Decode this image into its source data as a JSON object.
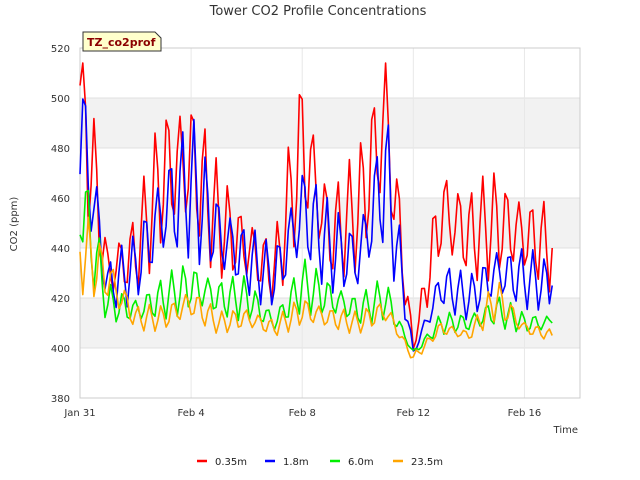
{
  "chart_data": {
    "type": "line",
    "title": "Tower CO2 Profile Concentrations",
    "badge": "TZ_co2prof",
    "xlabel": "Time",
    "ylabel": "CO2 (ppm)",
    "ylim": [
      380,
      520
    ],
    "yticks": [
      "380",
      "400",
      "420",
      "440",
      "460",
      "480",
      "500",
      "520"
    ],
    "xlim": [
      "2016-01-31",
      "2016-02-18"
    ],
    "xticks": [
      {
        "date": "2016-01-31",
        "label": "Jan 31"
      },
      {
        "date": "2016-02-04",
        "label": "Feb 4"
      },
      {
        "date": "2016-02-08",
        "label": "Feb 8"
      },
      {
        "date": "2016-02-12",
        "label": "Feb 12"
      },
      {
        "date": "2016-02-16",
        "label": "Feb 16"
      }
    ],
    "grid": true,
    "legend_position": "bottom",
    "x": [
      "2016-01-31",
      "2016-02-01",
      "2016-02-02",
      "2016-02-03",
      "2016-02-04",
      "2016-02-05",
      "2016-02-06",
      "2016-02-07",
      "2016-02-08",
      "2016-02-09",
      "2016-02-10",
      "2016-02-11",
      "2016-02-12",
      "2016-02-13",
      "2016-02-14",
      "2016-02-15",
      "2016-02-16",
      "2016-02-17"
    ],
    "series": [
      {
        "name": "0.35m",
        "color": "#ff0000",
        "values": [
          505,
          430,
          438,
          470,
          475,
          450,
          440,
          430,
          482,
          445,
          455,
          492,
          400,
          455,
          445,
          450,
          445,
          440
        ]
      },
      {
        "name": "1.8m",
        "color": "#0000ff",
        "values": [
          490,
          425,
          432,
          455,
          465,
          445,
          435,
          428,
          455,
          440,
          435,
          470,
          398,
          425,
          420,
          430,
          428,
          425
        ]
      },
      {
        "name": "6.0m",
        "color": "#00ee00",
        "values": [
          460,
          418,
          415,
          420,
          425,
          420,
          420,
          410,
          425,
          420,
          415,
          420,
          398,
          410,
          410,
          415,
          410,
          410
        ]
      },
      {
        "name": "23.5m",
        "color": "#ffa500",
        "values": [
          440,
          428,
          412,
          412,
          418,
          410,
          412,
          408,
          415,
          412,
          410,
          415,
          396,
          408,
          405,
          420,
          408,
          405
        ]
      }
    ]
  }
}
